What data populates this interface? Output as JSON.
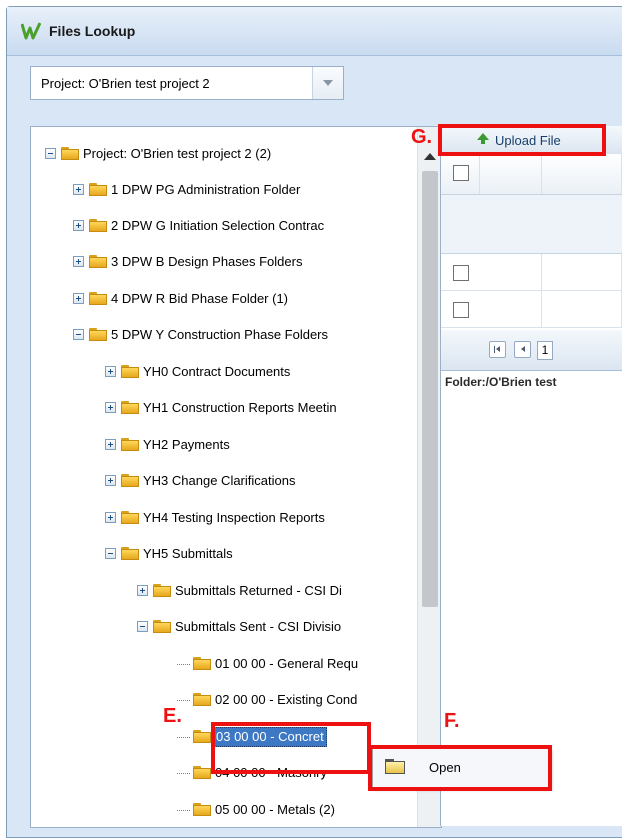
{
  "window": {
    "title": "Files Lookup",
    "app_icon": "w-logo-icon"
  },
  "project_selector": {
    "value": "Project: O'Brien test project 2"
  },
  "tree": {
    "nodes": [
      {
        "label": "Project: O'Brien test project 2 (2)",
        "expanded": true
      },
      {
        "label": "1 DPW PG Administration Folder",
        "expanded": false
      },
      {
        "label": "2 DPW G Initiation Selection Contrac",
        "expanded": false
      },
      {
        "label": "3 DPW B Design Phases Folders",
        "expanded": false
      },
      {
        "label": "4 DPW R Bid Phase Folder (1)",
        "expanded": false
      },
      {
        "label": "5 DPW Y Construction Phase Folders",
        "expanded": true
      },
      {
        "label": "YH0 Contract Documents",
        "expanded": false
      },
      {
        "label": "YH1 Construction Reports Meetin",
        "expanded": false
      },
      {
        "label": "YH2 Payments",
        "expanded": false
      },
      {
        "label": "YH3 Change Clarifications",
        "expanded": false
      },
      {
        "label": "YH4 Testing Inspection Reports",
        "expanded": false
      },
      {
        "label": "YH5 Submittals",
        "expanded": true
      },
      {
        "label": "Submittals Returned - CSI Di",
        "expanded": false
      },
      {
        "label": "Submittals Sent - CSI Divisio",
        "expanded": true
      },
      {
        "label": "01 00 00 - General Requ"
      },
      {
        "label": "02 00 00 - Existing Cond"
      },
      {
        "label": "03 00 00 - Concret",
        "selected": true
      },
      {
        "label": "04 00 00 - Masonry"
      },
      {
        "label": "05 00 00 - Metals (2)"
      }
    ]
  },
  "grid": {
    "toolbar": {
      "upload_label": "Upload File"
    },
    "pager": {
      "page": "1"
    },
    "folder_path": "Folder:/O'Brien test"
  },
  "context_menu": {
    "open_label": "Open"
  },
  "annotations": {
    "g": "G.",
    "e": "E.",
    "f": "F."
  },
  "colors": {
    "callout": "#ee1111",
    "selection": "#3d78c4",
    "folder": "#f0b93a"
  }
}
